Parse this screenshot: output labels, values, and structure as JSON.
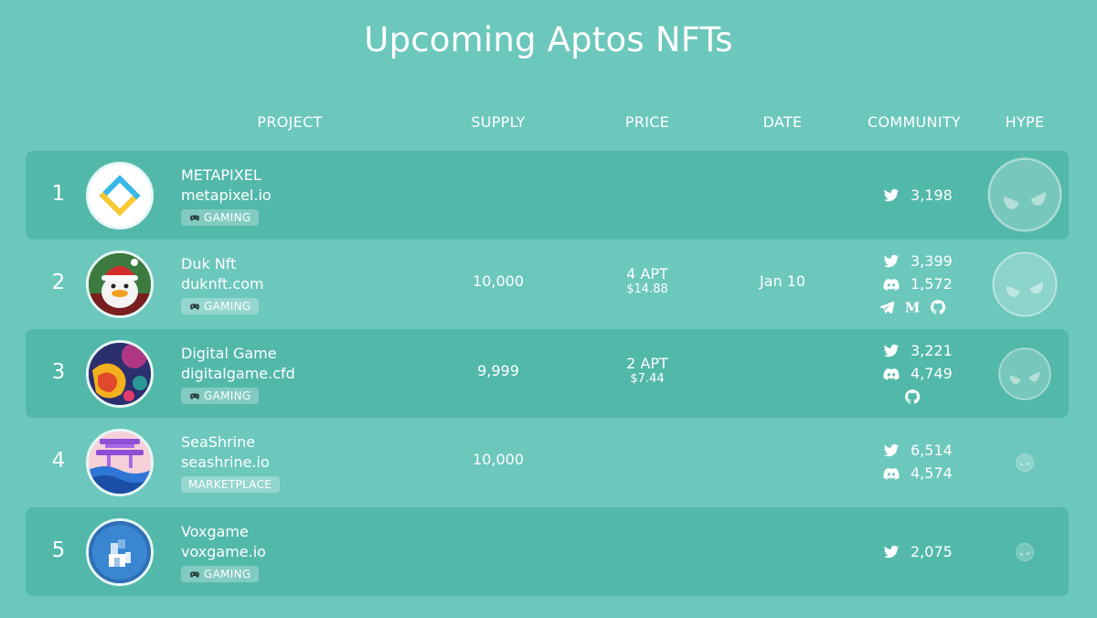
{
  "page": {
    "title": "Upcoming Aptos NFTs"
  },
  "columns": {
    "project": "PROJECT",
    "supply": "SUPPLY",
    "price": "PRICE",
    "date": "DATE",
    "community": "COMMUNITY",
    "hype": "HYPE"
  },
  "colors": {
    "background": "#6cc7bc",
    "row_alt": "#52b8aa",
    "text": "#ffffff"
  },
  "rows": [
    {
      "rank": "1",
      "name": "METAPIXEL",
      "url": "metapixel.io",
      "tag": "GAMING",
      "tag_icon": "gamepad-icon",
      "supply": "",
      "price_apt": "",
      "price_usd": "",
      "date": "",
      "twitter": "3,198",
      "discord": "",
      "avatar_icon": "metapixel-logo"
    },
    {
      "rank": "2",
      "name": "Duk Nft",
      "url": "duknft.com",
      "tag": "GAMING",
      "tag_icon": "gamepad-icon",
      "supply": "10,000",
      "price_apt": "4 APT",
      "price_usd": "$14.88",
      "date": "Jan 10",
      "twitter": "3,399",
      "discord": "1,572",
      "extra_icons": [
        "telegram-icon",
        "medium-icon",
        "github-icon"
      ],
      "avatar_icon": "duck-avatar"
    },
    {
      "rank": "3",
      "name": "Digital Game",
      "url": "digitalgame.cfd",
      "tag": "GAMING",
      "tag_icon": "gamepad-icon",
      "supply": "9,999",
      "price_apt": "2 APT",
      "price_usd": "$7.44",
      "date": "",
      "twitter": "3,221",
      "discord": "4,749",
      "extra_icons": [
        "github-icon"
      ],
      "avatar_icon": "digital-art-avatar"
    },
    {
      "rank": "4",
      "name": "SeaShrine",
      "url": "seashrine.io",
      "tag": "MARKETPLACE",
      "tag_icon": "",
      "supply": "10,000",
      "price_apt": "",
      "price_usd": "",
      "date": "",
      "twitter": "6,514",
      "discord": "4,574",
      "avatar_icon": "shrine-avatar"
    },
    {
      "rank": "5",
      "name": "Voxgame",
      "url": "voxgame.io",
      "tag": "GAMING",
      "tag_icon": "gamepad-icon",
      "supply": "",
      "price_apt": "",
      "price_usd": "",
      "date": "",
      "twitter": "2,075",
      "discord": "",
      "avatar_icon": "voxel-avatar"
    }
  ],
  "hype_icon": "angry-face-icon"
}
